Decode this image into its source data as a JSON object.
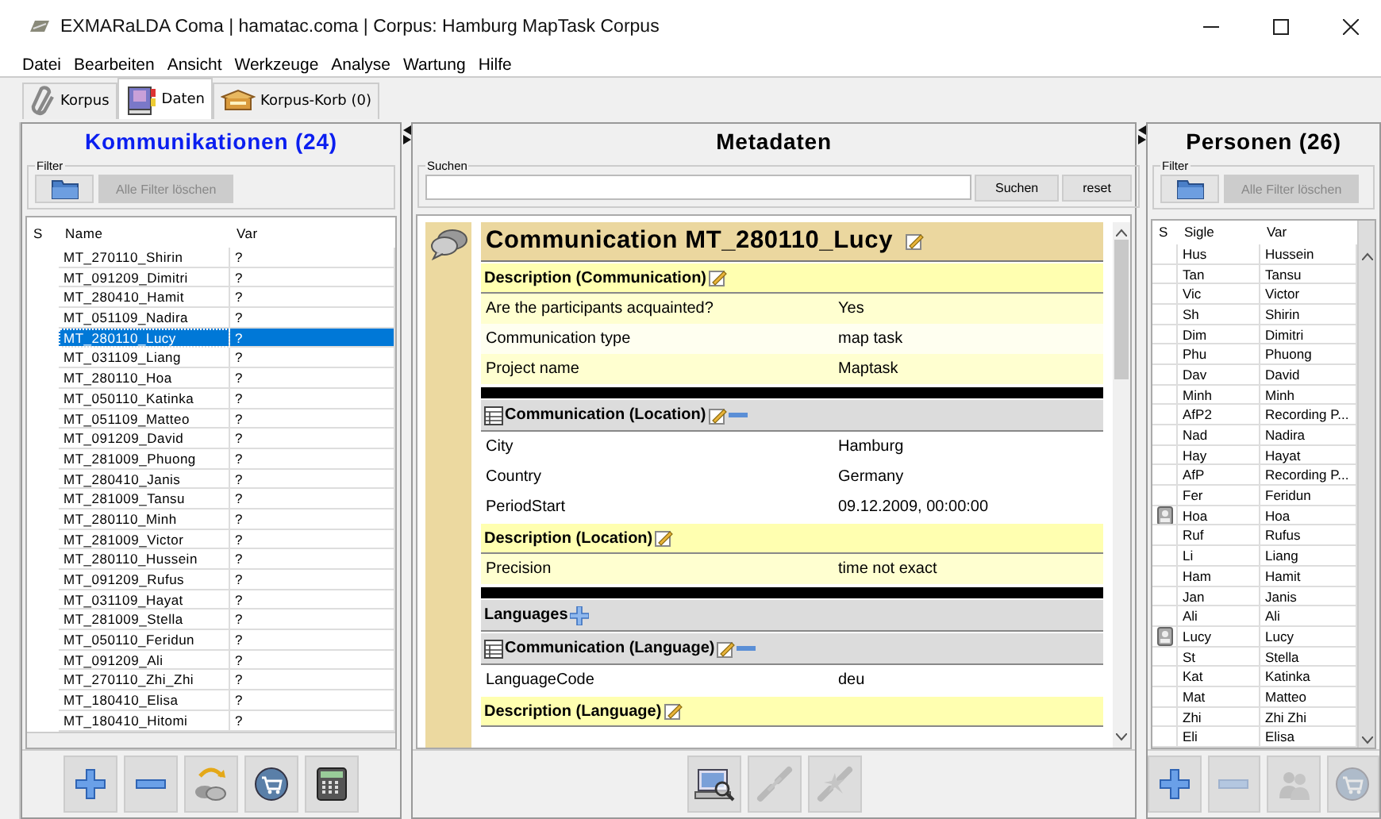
{
  "window": {
    "title": "EXMARaLDA Coma | hamatac.coma | Corpus: Hamburg MapTask Corpus"
  },
  "menu": [
    "Datei",
    "Bearbeiten",
    "Ansicht",
    "Werkzeuge",
    "Analyse",
    "Wartung",
    "Hilfe"
  ],
  "tabs": [
    {
      "label": "Korpus",
      "kind": "korpus",
      "selected": false
    },
    {
      "label": "Daten",
      "kind": "daten",
      "selected": true
    },
    {
      "label": "Korpus-Korb (0)",
      "kind": "korb",
      "selected": false
    }
  ],
  "communications": {
    "title": "Kommunikationen (24)",
    "filter_legend": "Filter",
    "clear_filter": {
      "label": "Alle Filter löschen",
      "disabled": true
    },
    "columns": [
      "S",
      "Name",
      "Var"
    ],
    "rows": [
      {
        "name": "MT_270110_Shirin",
        "var": "?",
        "selected": false
      },
      {
        "name": "MT_091209_Dimitri",
        "var": "?",
        "selected": false
      },
      {
        "name": "MT_280410_Hamit",
        "var": "?",
        "selected": false
      },
      {
        "name": "MT_051109_Nadira",
        "var": "?",
        "selected": false
      },
      {
        "name": "MT_280110_Lucy",
        "var": "?",
        "selected": true
      },
      {
        "name": "MT_031109_Liang",
        "var": "?",
        "selected": false
      },
      {
        "name": "MT_280110_Hoa",
        "var": "?",
        "selected": false
      },
      {
        "name": "MT_050110_Katinka",
        "var": "?",
        "selected": false
      },
      {
        "name": "MT_051109_Matteo",
        "var": "?",
        "selected": false
      },
      {
        "name": "MT_091209_David",
        "var": "?",
        "selected": false
      },
      {
        "name": "MT_281009_Phuong",
        "var": "?",
        "selected": false
      },
      {
        "name": "MT_280410_Janis",
        "var": "?",
        "selected": false
      },
      {
        "name": "MT_281009_Tansu",
        "var": "?",
        "selected": false
      },
      {
        "name": "MT_280110_Minh",
        "var": "?",
        "selected": false
      },
      {
        "name": "MT_281009_Victor",
        "var": "?",
        "selected": false
      },
      {
        "name": "MT_280110_Hussein",
        "var": "?",
        "selected": false
      },
      {
        "name": "MT_091209_Rufus",
        "var": "?",
        "selected": false
      },
      {
        "name": "MT_031109_Hayat",
        "var": "?",
        "selected": false
      },
      {
        "name": "MT_281009_Stella",
        "var": "?",
        "selected": false
      },
      {
        "name": "MT_050110_Feridun",
        "var": "?",
        "selected": false
      },
      {
        "name": "MT_091209_Ali",
        "var": "?",
        "selected": false
      },
      {
        "name": "MT_270110_Zhi_Zhi",
        "var": "?",
        "selected": false
      },
      {
        "name": "MT_180410_Elisa",
        "var": "?",
        "selected": false
      },
      {
        "name": "MT_180410_Hitomi",
        "var": "?",
        "selected": false
      }
    ],
    "toolbar": [
      {
        "kind": "add",
        "disabled": false
      },
      {
        "kind": "remove",
        "disabled": false
      },
      {
        "kind": "assign",
        "disabled": false
      },
      {
        "kind": "basket",
        "disabled": false
      },
      {
        "kind": "calculator",
        "disabled": false
      }
    ]
  },
  "metadata": {
    "title": "Metadaten",
    "search_legend": "Suchen",
    "search_button": "Suchen",
    "reset_button": "reset",
    "heading": "Communication MT_280110_Lucy",
    "sections": [
      {
        "kind": "description",
        "title": "Description (Communication)",
        "rows": [
          {
            "key": "Are the participants acquainted?",
            "value": "Yes"
          },
          {
            "key": "Communication type",
            "value": "map task"
          },
          {
            "key": "Project name",
            "value": "Maptask"
          }
        ]
      },
      {
        "kind": "separator"
      },
      {
        "kind": "group",
        "title": "Communication (Location)",
        "rows": [
          {
            "key": "City",
            "value": "Hamburg"
          },
          {
            "key": "Country",
            "value": "Germany"
          },
          {
            "key": "PeriodStart",
            "value": "09.12.2009, 00:00:00"
          }
        ]
      },
      {
        "kind": "description",
        "title": "Description (Location)",
        "rows": [
          {
            "key": "Precision",
            "value": "time not exact"
          }
        ]
      },
      {
        "kind": "separator"
      },
      {
        "kind": "list",
        "title": "Languages"
      },
      {
        "kind": "group",
        "title": "Communication (Language)",
        "rows": [
          {
            "key": "LanguageCode",
            "value": "deu"
          }
        ]
      },
      {
        "kind": "description",
        "title": "Description (Language)"
      }
    ],
    "toolbar": [
      {
        "kind": "inspect",
        "disabled": false
      },
      {
        "kind": "link",
        "disabled": true
      },
      {
        "kind": "unlink",
        "disabled": true
      }
    ]
  },
  "persons": {
    "title": "Personen (26)",
    "filter_legend": "Filter",
    "clear_filter": {
      "label": "Alle Filter löschen",
      "disabled": true
    },
    "columns": [
      "S",
      "Sigle",
      "Var"
    ],
    "rows": [
      {
        "sigle": "Hus",
        "var": "Hussein",
        "linked": false
      },
      {
        "sigle": "Tan",
        "var": "Tansu",
        "linked": false
      },
      {
        "sigle": "Vic",
        "var": "Victor",
        "linked": false
      },
      {
        "sigle": "Sh",
        "var": "Shirin",
        "linked": false
      },
      {
        "sigle": "Dim",
        "var": "Dimitri",
        "linked": false
      },
      {
        "sigle": "Phu",
        "var": "Phuong",
        "linked": false
      },
      {
        "sigle": "Dav",
        "var": "David",
        "linked": false
      },
      {
        "sigle": "Minh",
        "var": "Minh",
        "linked": false
      },
      {
        "sigle": "AfP2",
        "var": "Recording P...",
        "linked": false
      },
      {
        "sigle": "Nad",
        "var": "Nadira",
        "linked": false
      },
      {
        "sigle": "Hay",
        "var": "Hayat",
        "linked": false
      },
      {
        "sigle": "AfP",
        "var": "Recording P...",
        "linked": false
      },
      {
        "sigle": "Fer",
        "var": "Feridun",
        "linked": false
      },
      {
        "sigle": "Hoa",
        "var": "Hoa",
        "linked": true
      },
      {
        "sigle": "Ruf",
        "var": "Rufus",
        "linked": false
      },
      {
        "sigle": "Li",
        "var": "Liang",
        "linked": false
      },
      {
        "sigle": "Ham",
        "var": "Hamit",
        "linked": false
      },
      {
        "sigle": "Jan",
        "var": "Janis",
        "linked": false
      },
      {
        "sigle": "Ali",
        "var": "Ali",
        "linked": false
      },
      {
        "sigle": "Lucy",
        "var": "Lucy",
        "linked": true
      },
      {
        "sigle": "St",
        "var": "Stella",
        "linked": false
      },
      {
        "sigle": "Kat",
        "var": "Katinka",
        "linked": false
      },
      {
        "sigle": "Mat",
        "var": "Matteo",
        "linked": false
      },
      {
        "sigle": "Zhi",
        "var": "Zhi Zhi",
        "linked": false
      },
      {
        "sigle": "Eli",
        "var": "Elisa",
        "linked": false
      }
    ],
    "toolbar": [
      {
        "kind": "add",
        "disabled": false
      },
      {
        "kind": "remove",
        "disabled": true
      },
      {
        "kind": "persons",
        "disabled": true
      },
      {
        "kind": "basket",
        "disabled": true
      }
    ]
  }
}
